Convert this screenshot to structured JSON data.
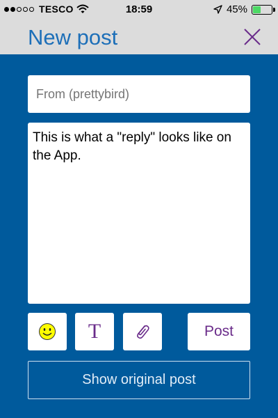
{
  "status_bar": {
    "carrier": "TESCO",
    "time": "18:59",
    "battery_percent": "45%",
    "battery_level": 0.45,
    "icons": [
      "signal-dots-icon",
      "wifi-icon",
      "location-arrow-icon",
      "battery-icon"
    ]
  },
  "nav": {
    "title": "New post",
    "close_icon": "close-icon"
  },
  "compose": {
    "from_placeholder": "From (prettybird)",
    "message_text": "This is what a \"reply\" looks like on the App."
  },
  "toolbar": {
    "emoji_icon": "smiley-icon",
    "text_format_label": "T",
    "attach_icon": "paperclip-icon",
    "post_label": "Post"
  },
  "footer": {
    "show_original_label": "Show original post"
  },
  "colors": {
    "background": "#005a9c",
    "bar": "#dcdcdc",
    "title": "#1d6fb8",
    "accent_purple": "#6a2c8a",
    "battery": "#4cd964",
    "smiley": "#ffff00"
  }
}
